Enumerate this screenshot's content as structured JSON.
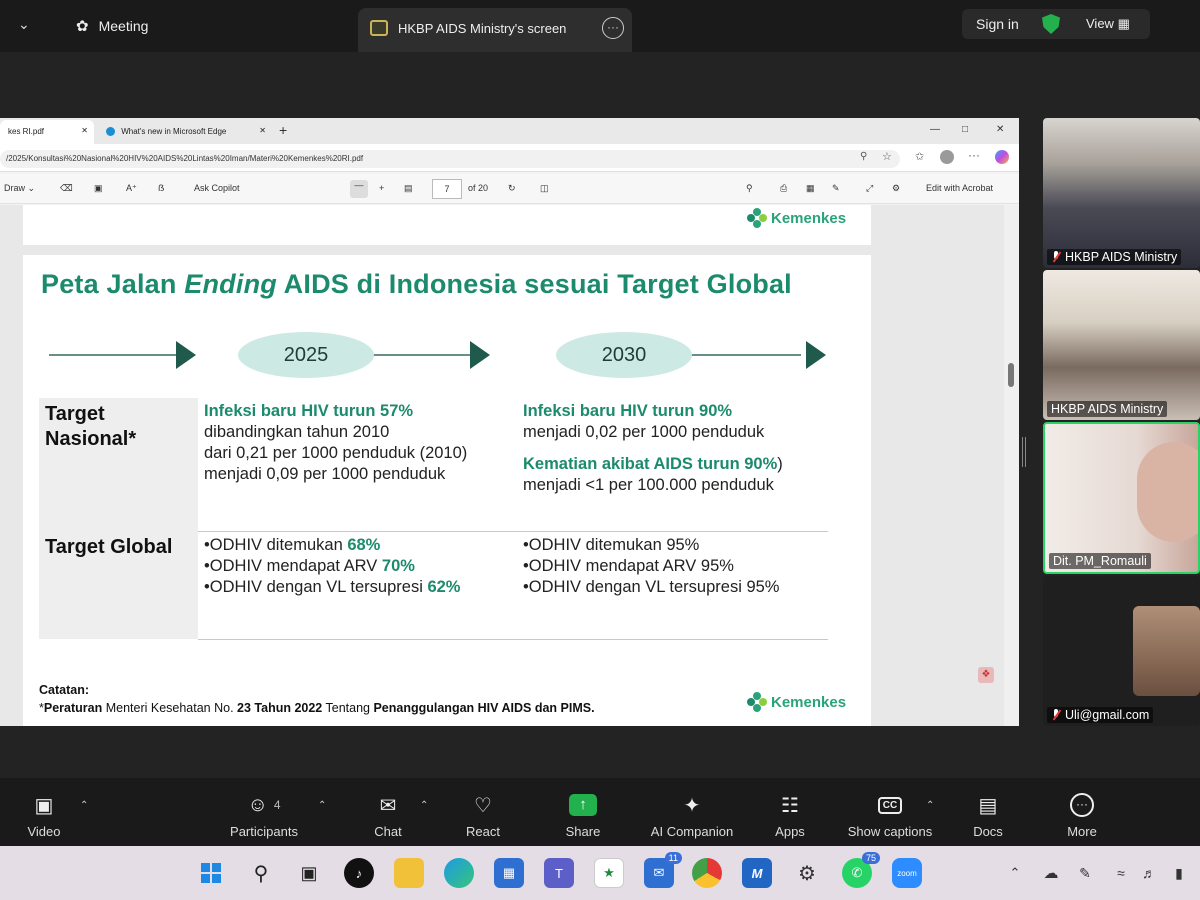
{
  "topbar": {
    "meeting_label": "Meeting",
    "screen_tab_label": "HKBP AIDS Ministry's screen",
    "sign_in": "Sign in",
    "view": "View"
  },
  "browser": {
    "tab1": "kes RI.pdf",
    "tab2": "What's new in Microsoft Edge",
    "url": "/2025/Konsultasi%20Nasional%20HIV%20AIDS%20Lintas%20Iman/Materi%20Kemenkes%20RI.pdf",
    "toolbar": {
      "draw": "Draw",
      "ask_copilot": "Ask Copilot",
      "page_number": "7",
      "page_total": "of 20",
      "edit_acrobat": "Edit with Acrobat"
    }
  },
  "slide": {
    "brand": "Kemenkes",
    "title_part1": "Peta Jalan ",
    "title_italic": "Ending",
    "title_part2": " AIDS di Indonesia sesuai Target Global",
    "year1": "2025",
    "year2": "2030",
    "nasional_label_1": "Target",
    "nasional_label_2": "Nasional*",
    "global_label": "Target Global",
    "n2025": {
      "headline": "Infeksi baru HIV turun 57%",
      "line2": "dibandingkan tahun 2010",
      "line3": "dari 0,21 per 1000 penduduk (2010)",
      "line4": "menjadi 0,09 per 1000 penduduk"
    },
    "n2030": {
      "headline1": "Infeksi baru HIV turun 90%",
      "line2": "menjadi 0,02 per 1000 penduduk",
      "headline2": "Kematian akibat AIDS turun 90%",
      "headline2_suffix": ")",
      "line4": "menjadi <1 per 100.000 penduduk"
    },
    "g2025": [
      {
        "text": "•ODHIV ditemukan ",
        "value": "68%"
      },
      {
        "text": "•ODHIV mendapat ARV ",
        "value": "70%"
      },
      {
        "text": "•ODHIV dengan VL tersupresi ",
        "value": "62%"
      }
    ],
    "g2030": [
      "•ODHIV ditemukan 95%",
      "•ODHIV mendapat ARV 95%",
      "•ODHIV dengan VL tersupresi 95%"
    ],
    "note_label": "Catatan:",
    "note_star": "*",
    "note_b1": "Peraturan",
    "note_t1": " Menteri Kesehatan No. ",
    "note_b2": "23 Tahun 2022",
    "note_t2": " Tentang ",
    "note_b3": "Penanggulangan HIV AIDS dan PIMS."
  },
  "participants": [
    {
      "name": "HKBP AIDS Ministry",
      "muted": true
    },
    {
      "name": "HKBP AIDS Ministry",
      "muted": false
    },
    {
      "name": "Dit. PM_Romauli",
      "muted": false
    },
    {
      "name": "Uli@gmail.com",
      "muted": true
    }
  ],
  "controls": {
    "video": "Video",
    "participants": "Participants",
    "participants_count": "4",
    "chat": "Chat",
    "react": "React",
    "share": "Share",
    "ai": "AI Companion",
    "apps": "Apps",
    "captions": "Show captions",
    "docs": "Docs",
    "more": "More"
  },
  "taskbar": {
    "teams_badge": "11",
    "whatsapp_badge": "75",
    "zoom_label": "zoom"
  },
  "colors": {
    "brand_green": "#1c8a6d",
    "share_green": "#23b14d",
    "pill": "#cde9e4"
  }
}
